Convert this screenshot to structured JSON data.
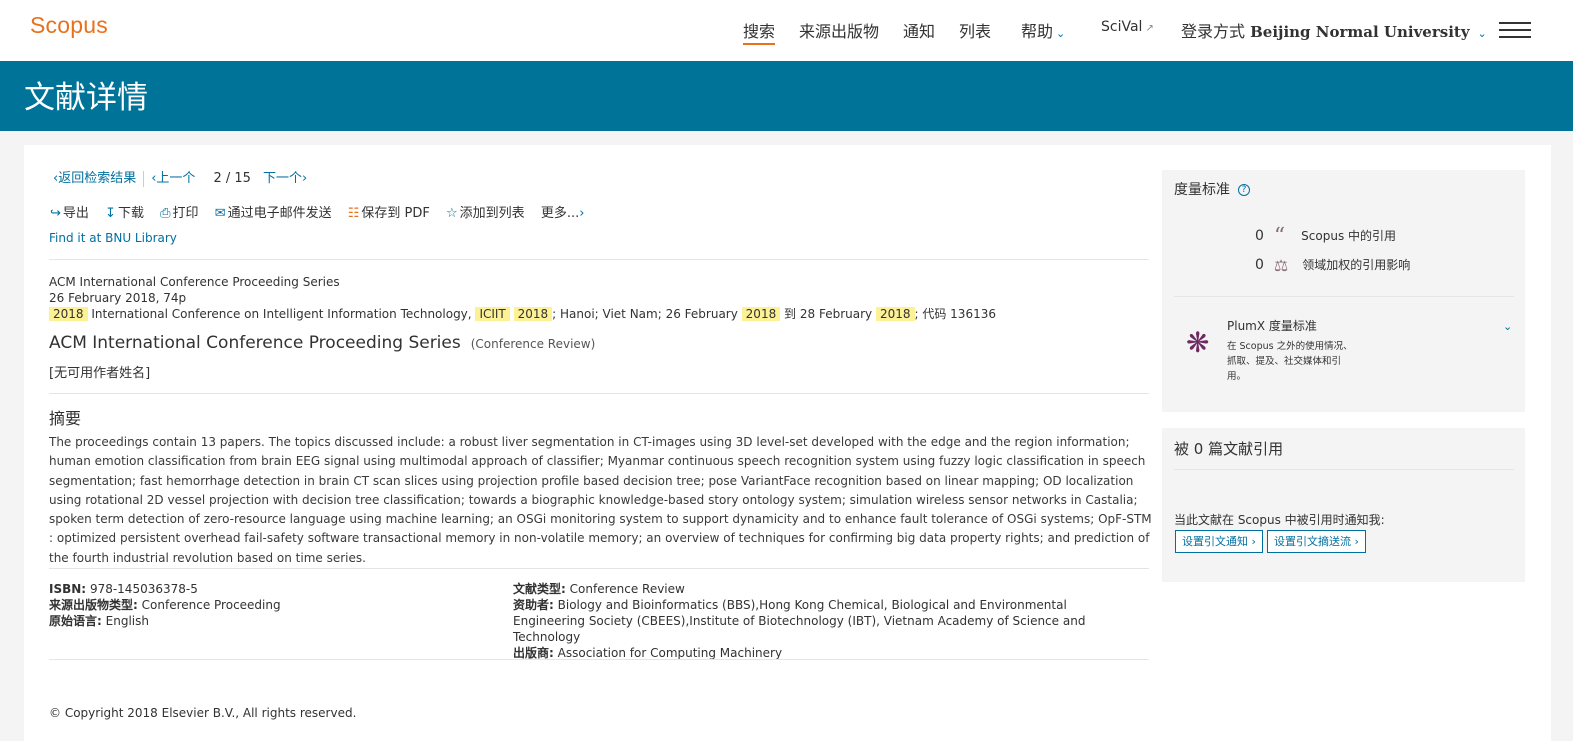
{
  "header": {
    "logo": "Scopus",
    "nav": [
      {
        "label": "搜索"
      },
      {
        "label": "来源出版物"
      },
      {
        "label": "通知"
      },
      {
        "label": "列表"
      },
      {
        "label": "帮助"
      }
    ],
    "scival": "SciVal",
    "login_prefix": "登录方式",
    "login_institution": "Beijing Normal University"
  },
  "banner": {
    "title": "文献详情"
  },
  "breadcrumb": {
    "back": "返回检索结果",
    "prev": "上一个",
    "page_current": "2",
    "page_sep": "/",
    "page_total": "15",
    "next": "下一个"
  },
  "actions": {
    "export": "导出",
    "download": "下载",
    "print": "打印",
    "email": "通过电子邮件发送",
    "save_pdf": "保存到 PDF",
    "add_list": "添加到列表",
    "more": "更多..."
  },
  "find_it": "Find it at BNU Library",
  "source": {
    "series": "ACM International Conference Proceeding Series",
    "date_pages": "26 February 2018, 74p",
    "conf_year1": "2018",
    "conf_name": "International Conference on Intelligent Information Technology,",
    "conf_abbr": "ICIIT",
    "conf_year2": "2018",
    "conf_place": "; Hanoi; Viet Nam; 26 February",
    "conf_year3": "2018",
    "conf_to": "到 28 February",
    "conf_year4": "2018",
    "conf_code": "; 代码 136136"
  },
  "document": {
    "title": "ACM International Conference Proceeding Series",
    "type": "(Conference Review)",
    "authors": "[无可用作者姓名]"
  },
  "abstract": {
    "heading": "摘要",
    "text": "The proceedings contain 13 papers. The topics discussed include: a robust liver segmentation in CT-images using 3D level-set developed with the edge and the region information; human emotion classification from brain EEG signal using multimodal approach of classifier; Myanmar continuous speech recognition system using fuzzy logic classification in speech segmentation; fast hemorrhage detection in brain CT scan slices using projection profile based decision tree; pose VariantFace recognition based on linear mapping; OD localization using rotational 2D vessel projection with decision tree classification; towards a biographic knowledge-based story ontology system; simulation wireless sensor networks in Castalia; spoken term detection of zero-resource language using machine learning; an OSGi monitoring system to support dynamicity and to enhance fault tolerance of OSGi systems; OpF-STM : optimized persistent overhead fail-safety software transactional memory in non-volatile memory; an overview of techniques for confirming big data property rights; and prediction of the fourth industrial revolution based on time series."
  },
  "details": {
    "isbn_label": "ISBN:",
    "isbn": "978-145036378-5",
    "source_type_label": "来源出版物类型:",
    "source_type": "Conference Proceeding",
    "language_label": "原始语言:",
    "language": "English",
    "doc_type_label": "文献类型:",
    "doc_type": "Conference Review",
    "sponsor_label": "资助者:",
    "sponsor": "Biology and Bioinformatics (BBS),Hong Kong Chemical, Biological and Environmental Engineering Society (CBEES),Institute of Biotechnology (IBT), Vietnam Academy of Science and Technology",
    "publisher_label": "出版商:",
    "publisher": "Association for Computing Machinery"
  },
  "copyright": "© Copyright 2018 Elsevier B.V., All rights reserved.",
  "metrics": {
    "title": "度量标准",
    "citations_count": "0",
    "citations_label": "Scopus 中的引用",
    "fwci_count": "0",
    "fwci_label": "领域加权的引用影响",
    "plumx_title": "PlumX 度量标准",
    "plumx_desc": "在 Scopus 之外的使用情况、抓取、提及、社交媒体和引用。"
  },
  "cited_by": {
    "title": "被 0 篇文献引用",
    "notify": "当此文献在 Scopus 中被引用时通知我:",
    "btn_alert": "设置引文通知",
    "btn_feed": "设置引文摘送流"
  }
}
